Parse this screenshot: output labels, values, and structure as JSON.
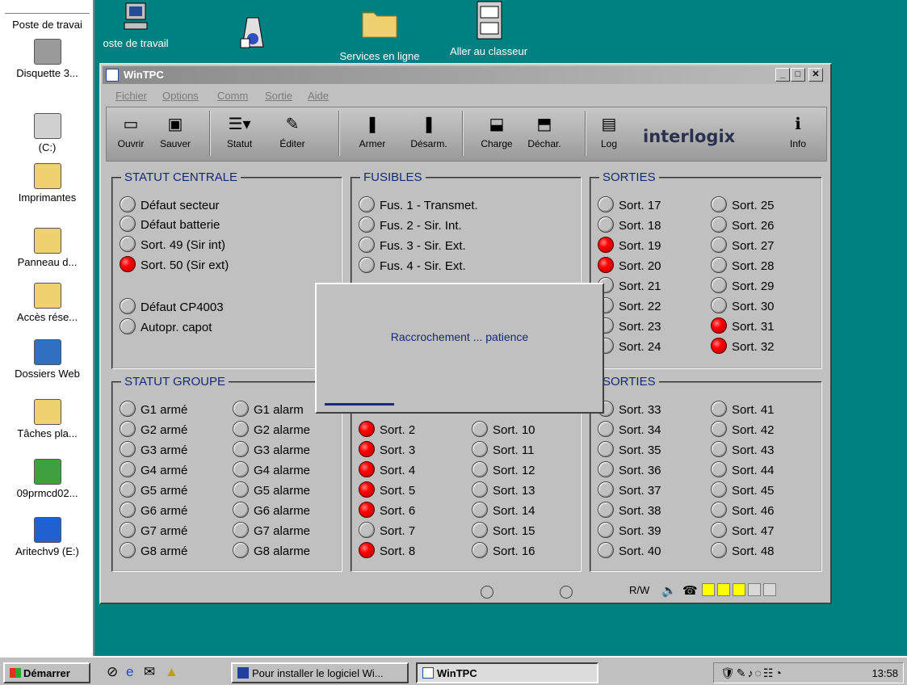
{
  "desktop": {
    "left_panel": {
      "items": [
        {
          "label": "Poste de travai",
          "icon": "computer-icon"
        },
        {
          "label": "Disquette 3...",
          "icon": "floppy-icon"
        },
        {
          "label": "(C:)",
          "icon": "drive-icon"
        },
        {
          "label": "Imprimantes",
          "icon": "printer-folder-icon"
        },
        {
          "label": "Panneau d...",
          "icon": "control-panel-icon"
        },
        {
          "label": "Accès rése...",
          "icon": "network-folder-icon"
        },
        {
          "label": "Dossiers Web",
          "icon": "web-folder-icon"
        },
        {
          "label": "Tâches pla...",
          "icon": "tasks-icon"
        },
        {
          "label": "09prmcd02...",
          "icon": "cdrom-icon"
        },
        {
          "label": "Aritechv9 (E:)",
          "icon": "cd-drive-icon"
        }
      ]
    },
    "top_icons": [
      {
        "label": "oste de travail",
        "icon": "computer-icon"
      },
      {
        "label": "",
        "icon": "shortcut-app-icon"
      },
      {
        "label": "Services en ligne",
        "icon": "folder-icon"
      },
      {
        "label": "Aller au classeur",
        "icon": "cabinet-icon"
      }
    ]
  },
  "window": {
    "title": "WinTPC",
    "controls": {
      "minimize": "_",
      "maximize": "□",
      "close": "✕"
    },
    "menu": [
      "Fichier",
      "Options",
      "Comm",
      "Sortie",
      "Aide"
    ],
    "toolbar": [
      {
        "label": "Ouvrir",
        "glyph": "▭"
      },
      {
        "label": "Sauver",
        "glyph": "▣"
      },
      {
        "label": "Statut",
        "glyph": "☰▾"
      },
      {
        "label": "Éditer",
        "glyph": "✎"
      },
      {
        "label": "Armer",
        "glyph": "❚"
      },
      {
        "label": "Désarm.",
        "glyph": "❚"
      },
      {
        "label": "Charge",
        "glyph": "⬓"
      },
      {
        "label": "Déchar.",
        "glyph": "⬒"
      },
      {
        "label": "Log",
        "glyph": "▤"
      },
      {
        "label": "Info",
        "glyph": "ℹ"
      }
    ],
    "logo": "interlogix",
    "statut_centrale": {
      "title": "STATUT CENTRALE",
      "items": [
        {
          "label": "Défaut secteur",
          "on": false
        },
        {
          "label": "Défaut batterie",
          "on": false
        },
        {
          "label": "Sort. 49 (Sir int)",
          "on": false
        },
        {
          "label": "Sort. 50 (Sir ext)",
          "on": true
        },
        {
          "label": "Défaut CP4003",
          "on": false
        },
        {
          "label": "Autopr. capot",
          "on": false
        }
      ]
    },
    "fusibles": {
      "title": "FUSIBLES",
      "items": [
        {
          "label": "Fus. 1 - Transmet.",
          "on": false
        },
        {
          "label": "Fus. 2 - Sir. Int.",
          "on": false
        },
        {
          "label": "Fus. 3 - Sir. Ext.",
          "on": false
        },
        {
          "label": "Fus. 4 - Sir. Ext.",
          "on": false
        }
      ]
    },
    "sorties_top": {
      "title": "SORTIES",
      "col1": [
        {
          "label": "Sort. 17",
          "on": false
        },
        {
          "label": "Sort. 18",
          "on": false
        },
        {
          "label": "Sort. 19",
          "on": true
        },
        {
          "label": "Sort. 20",
          "on": true
        },
        {
          "label": "Sort. 21",
          "on": false
        },
        {
          "label": "Sort. 22",
          "on": false
        },
        {
          "label": "Sort. 23",
          "on": false
        },
        {
          "label": "Sort. 24",
          "on": false
        }
      ],
      "col2": [
        {
          "label": "Sort. 25",
          "on": false
        },
        {
          "label": "Sort. 26",
          "on": false
        },
        {
          "label": "Sort. 27",
          "on": false
        },
        {
          "label": "Sort. 28",
          "on": false
        },
        {
          "label": "Sort. 29",
          "on": false
        },
        {
          "label": "Sort. 30",
          "on": false
        },
        {
          "label": "Sort. 31",
          "on": true
        },
        {
          "label": "Sort. 32",
          "on": true
        }
      ]
    },
    "statut_groupe": {
      "title": "STATUT GROUPE",
      "col1": [
        "G1 armé",
        "G2 armé",
        "G3 armé",
        "G4 armé",
        "G5 armé",
        "G6 armé",
        "G7 armé",
        "G8 armé"
      ],
      "col2": [
        "G1 alarm",
        "G2 alarme",
        "G3 alarme",
        "G4 alarme",
        "G5 alarme",
        "G6 alarme",
        "G7 alarme",
        "G8 alarme"
      ]
    },
    "sorties_mid": {
      "col1": [
        {
          "label": "Sort. 2",
          "on": true
        },
        {
          "label": "Sort. 3",
          "on": true
        },
        {
          "label": "Sort. 4",
          "on": true
        },
        {
          "label": "Sort. 5",
          "on": true
        },
        {
          "label": "Sort. 6",
          "on": true
        },
        {
          "label": "Sort. 7",
          "on": false
        },
        {
          "label": "Sort. 8",
          "on": true
        }
      ],
      "col2": [
        {
          "label": "Sort. 10",
          "on": false
        },
        {
          "label": "Sort. 11",
          "on": false
        },
        {
          "label": "Sort. 12",
          "on": false
        },
        {
          "label": "Sort. 13",
          "on": false
        },
        {
          "label": "Sort. 14",
          "on": false
        },
        {
          "label": "Sort. 15",
          "on": false
        },
        {
          "label": "Sort. 16",
          "on": false
        }
      ]
    },
    "sorties_bottom": {
      "title": "SORTIES",
      "col1": [
        "Sort. 33",
        "Sort. 34",
        "Sort. 35",
        "Sort. 36",
        "Sort. 37",
        "Sort. 38",
        "Sort. 39",
        "Sort. 40"
      ],
      "col2": [
        "Sort. 41",
        "Sort. 42",
        "Sort. 43",
        "Sort. 44",
        "Sort. 45",
        "Sort. 46",
        "Sort. 47",
        "Sort. 48"
      ]
    },
    "status_bar": {
      "mode": "R/W"
    },
    "dialog": {
      "message": "Raccrochement ... patience"
    }
  },
  "taskbar": {
    "start": "Démarrer",
    "tasks": [
      {
        "label": "Pour installer le logiciel Wi...",
        "active": false
      },
      {
        "label": "WinTPC",
        "active": true
      }
    ],
    "clock": "13:58"
  },
  "colors": {
    "desktop": "#008080",
    "window": "#c0c0c0",
    "group_title": "#14287a",
    "led_on": "#ff0000"
  }
}
